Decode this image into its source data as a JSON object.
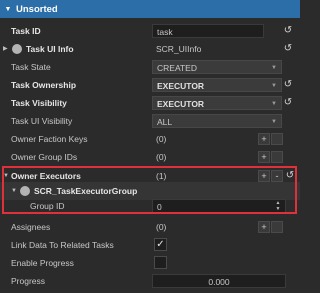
{
  "header": {
    "title": "Unsorted",
    "accent": "#2c6ea8"
  },
  "rows": {
    "task_id": {
      "label": "Task ID",
      "value": "task"
    },
    "task_ui_info": {
      "label": "Task UI Info",
      "value": "SCR_UIInfo"
    },
    "task_state": {
      "label": "Task State",
      "value": "CREATED"
    },
    "task_ownership": {
      "label": "Task Ownership",
      "value": "EXECUTOR"
    },
    "task_visibility": {
      "label": "Task Visibility",
      "value": "EXECUTOR"
    },
    "task_ui_visibility": {
      "label": "Task UI Visibility",
      "value": "ALL"
    },
    "owner_faction_keys": {
      "label": "Owner Faction Keys",
      "value": "(0)"
    },
    "owner_group_ids": {
      "label": "Owner Group IDs",
      "value": "(0)"
    },
    "owner_executors": {
      "label": "Owner Executors",
      "value": "(1)"
    },
    "executor_group": {
      "label": "SCR_TaskExecutorGroup"
    },
    "group_id": {
      "label": "Group ID",
      "value": "0"
    },
    "assignees": {
      "label": "Assignees",
      "value": "(0)"
    },
    "link_data": {
      "label": "Link Data To Related Tasks",
      "checked": true
    },
    "enable_progress": {
      "label": "Enable Progress",
      "checked": false
    },
    "progress": {
      "label": "Progress",
      "value": "0.000"
    }
  },
  "icons": {
    "plus": "+",
    "minus": "-",
    "reset": "↺",
    "check": "✓",
    "dropdown": "▼"
  },
  "highlight_color": "#e0303a"
}
